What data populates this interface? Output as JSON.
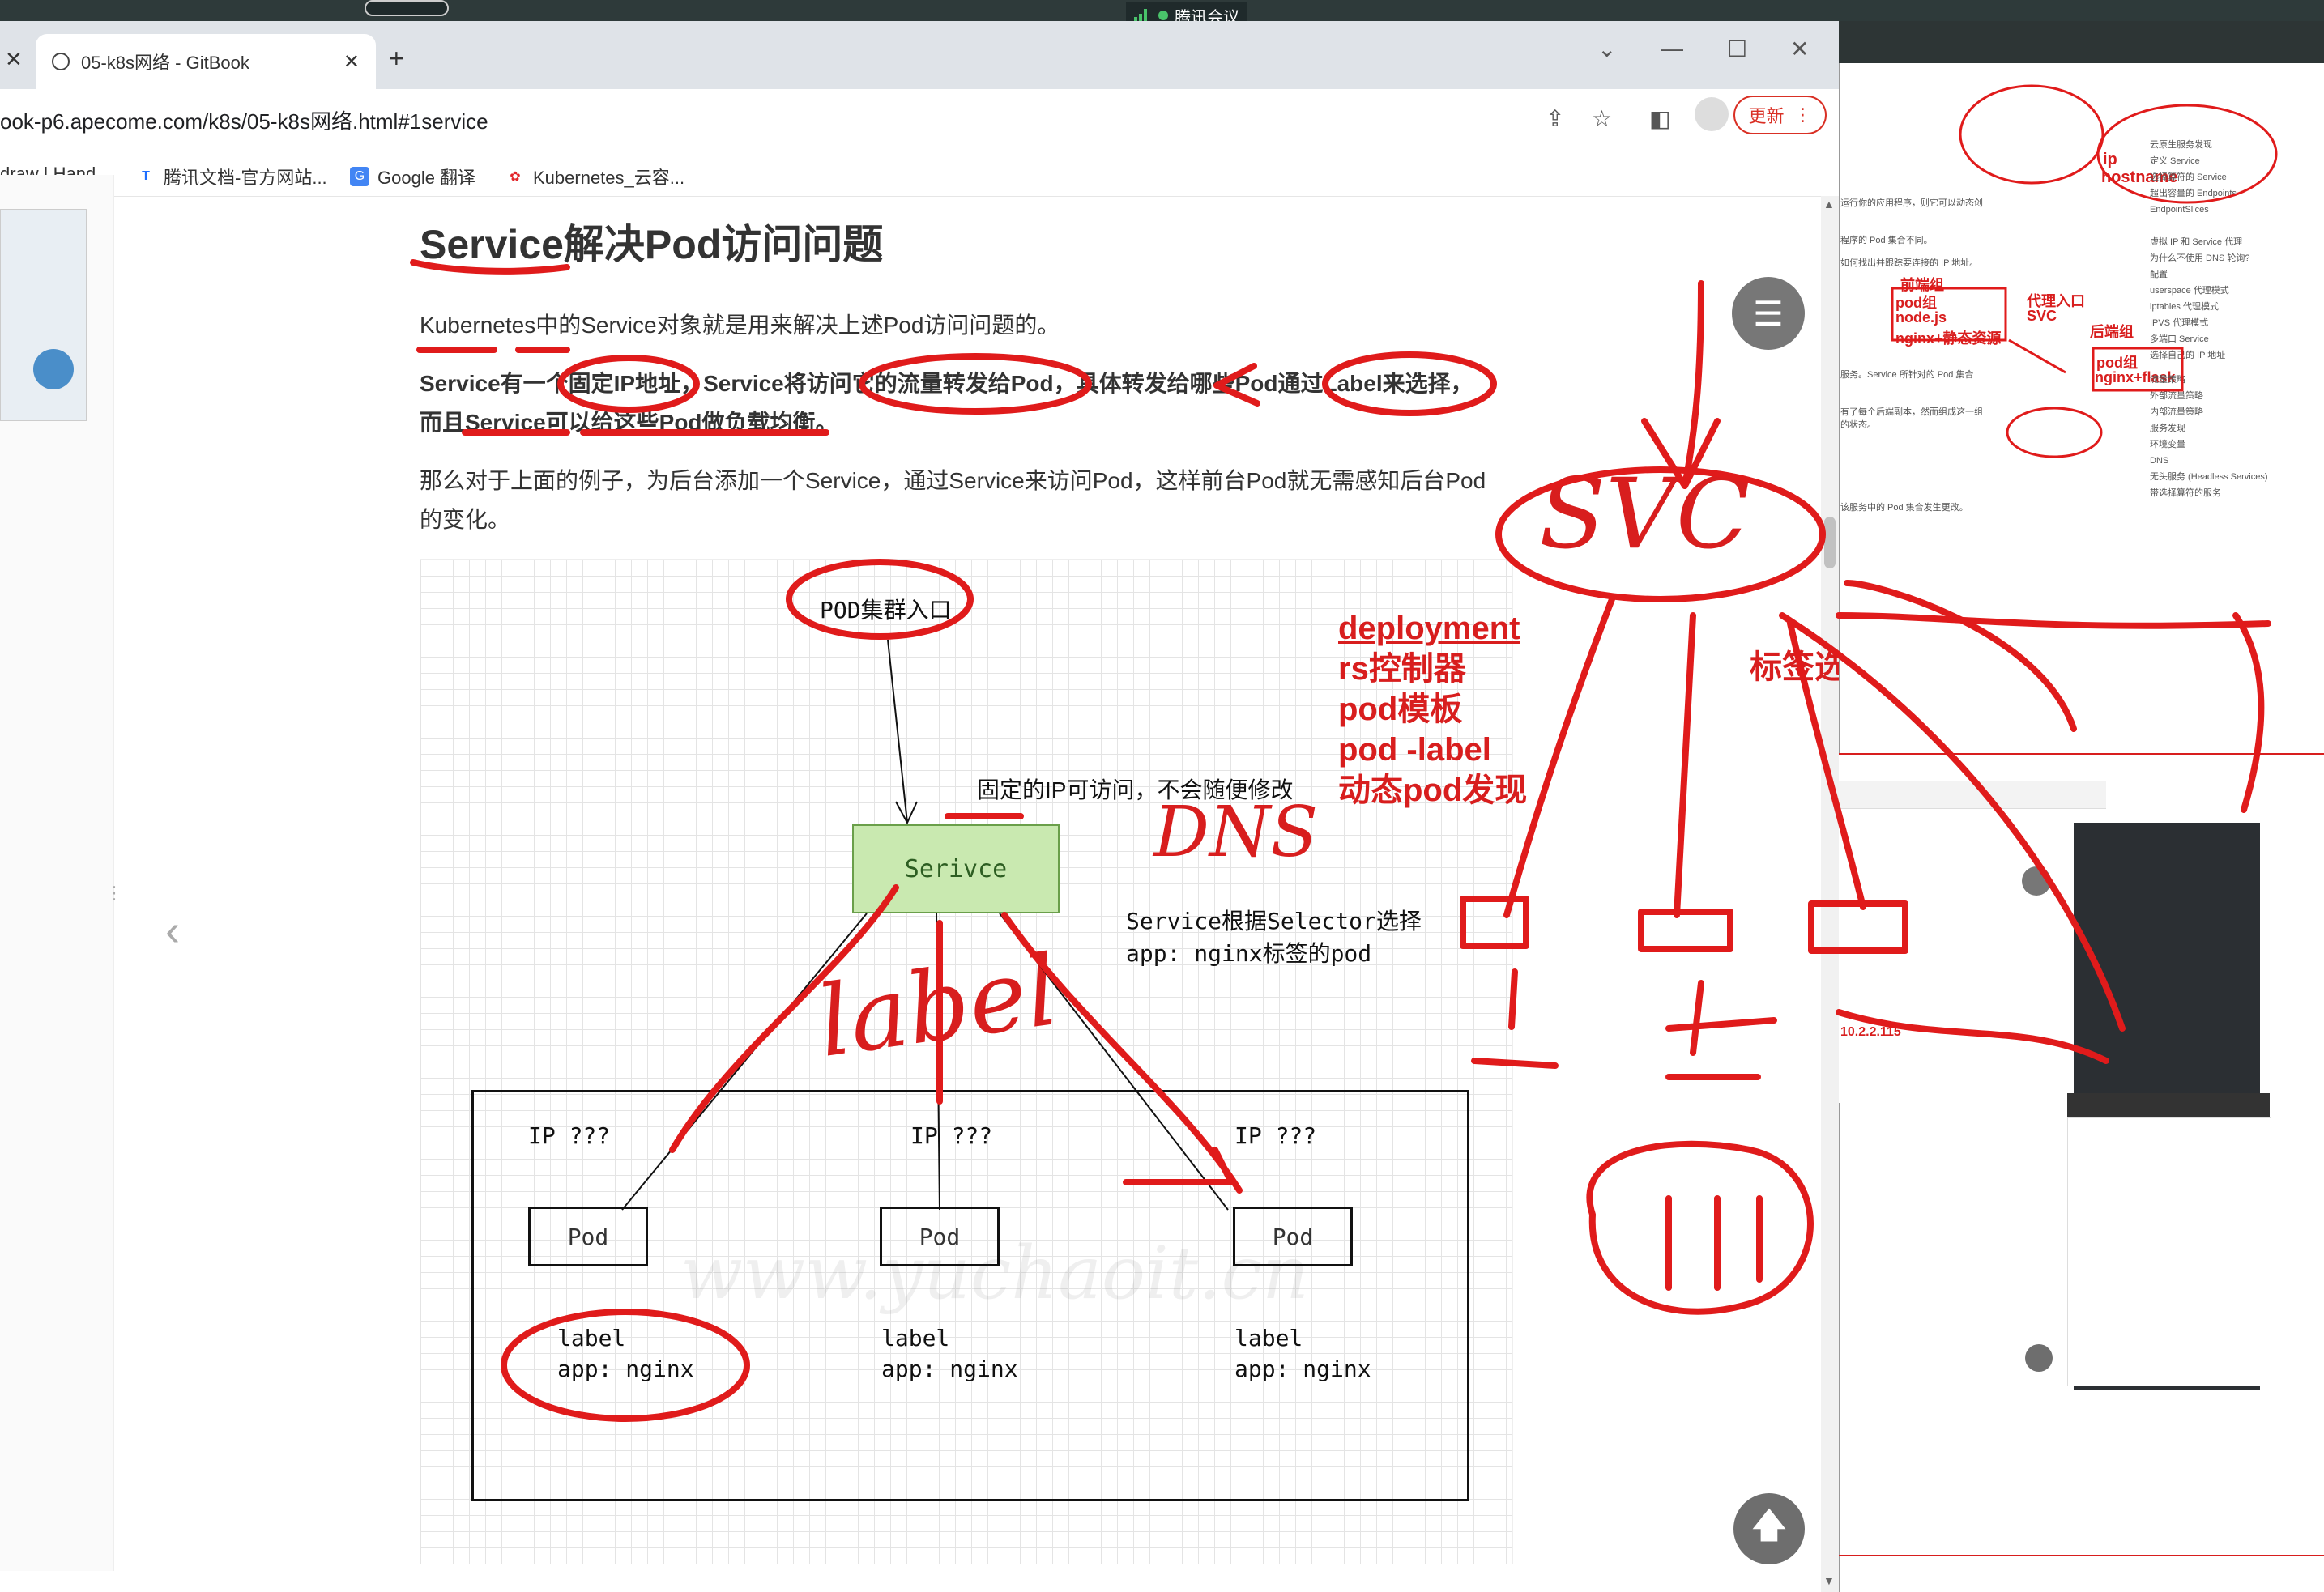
{
  "meeting": {
    "app_name": "腾讯会议"
  },
  "browser": {
    "tabs": [
      {
        "title": "05-k8s网络 - GitBook"
      }
    ],
    "new_tab_label": "+",
    "url": "ook-p6.apecome.com/k8s/05-k8s网络.html#1service",
    "update_button": "更新",
    "bookmarks": [
      {
        "label": "draw | Hand..."
      },
      {
        "label": "腾讯文档-官方网站..."
      },
      {
        "label": "Google 翻译"
      },
      {
        "label": "Kubernetes_云容..."
      }
    ]
  },
  "article": {
    "title": "Service解决Pod访问问题",
    "para1": "Kubernetes中的Service对象就是用来解决上述Pod访问问题的。",
    "para2_line1": "Service有一个固定IP地址，Service将访问它的流量转发给Pod，具体转发给哪些Pod通过Label来选择，",
    "para2_line2": "而且Service可以给这些Pod做负载均衡。",
    "para3_line1": "那么对于上面的例子，为后台添加一个Service，通过Service来访问Pod，这样前台Pod就无需感知后台Pod",
    "para3_line2": "的变化。"
  },
  "diagram": {
    "entry_label": "POD集群入口",
    "fixed_ip_note": "固定的IP可访问，不会随便修改",
    "service_label": "Serivce",
    "selector_note_line1": "Service根据Selector选择",
    "selector_note_line2": "app: nginx标签的pod",
    "ip_labels": [
      "IP ???",
      "IP ???",
      "IP ???"
    ],
    "pods": [
      "Pod",
      "Pod",
      "Pod"
    ],
    "pod_labels": [
      {
        "line1": "label",
        "line2": "app: nginx"
      },
      {
        "line1": "label",
        "line2": "app: nginx"
      },
      {
        "line1": "label",
        "line2": "app: nginx"
      }
    ],
    "watermark": "www.yuchaoit.cn"
  },
  "annotations": {
    "terms": [
      "deployment",
      "rs控制器",
      "pod模板",
      "pod -label",
      "动态pod发现"
    ],
    "dns": "DNS",
    "label_scrawl": "label",
    "svc": "SVC",
    "tag_selector": "标签选择器"
  },
  "right_panel": {
    "ip_label": "ip",
    "hostname_label": "hostname",
    "frontend_group": "前端组",
    "pod_group": "pod组",
    "nodejs": "node.js",
    "nginx_static": "nginx+静态资源",
    "proxy_entry": "代理入口",
    "svc": "SVC",
    "backend_group": "后端组",
    "pod_group2": "pod组",
    "nginx_flask": "nginx+flask",
    "ip_value": "10.2.2.115",
    "mini_lines": [
      "运行你的应用程序，则它可以动态创",
      "程序的 Pod 集合不同。",
      "如何找出并跟踪要连接的 IP 地址。",
      "服务。Service 所针对的 Pod 集合",
      "有了每个后端副本，然而组成这一组",
      "的状态。",
      "该服务中的 Pod 集合发生更改。"
    ],
    "toc": [
      "云原生服务发现",
      "定义 Service",
      "选择算符的 Service",
      "超出容量的 Endpoints",
      "EndpointSlices",
      "虚拟 IP 和 Service 代理",
      "为什么不使用 DNS 轮询?",
      "配置",
      "userspace 代理模式",
      "iptables 代理模式",
      "IPVS 代理模式",
      "多端口 Service",
      "选择自己的 IP 地址",
      "流量策略",
      "外部流量策略",
      "内部流量策略",
      "服务发现",
      "环境变量",
      "DNS",
      "无头服务 (Headless Services)",
      "带选择算符的服务"
    ]
  }
}
